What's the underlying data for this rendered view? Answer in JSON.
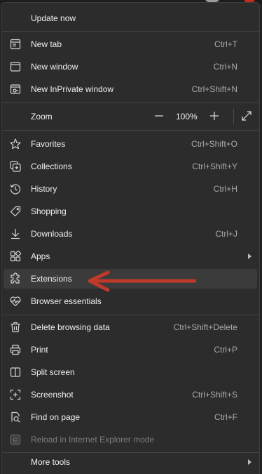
{
  "menu": {
    "update": {
      "label": "Update now"
    },
    "new_tab": {
      "label": "New tab",
      "shortcut": "Ctrl+T",
      "icon": "new-tab-icon"
    },
    "new_window": {
      "label": "New window",
      "shortcut": "Ctrl+N",
      "icon": "window-icon"
    },
    "inprivate": {
      "label": "New InPrivate window",
      "shortcut": "Ctrl+Shift+N",
      "icon": "inprivate-icon"
    },
    "zoom": {
      "label": "Zoom",
      "value": "100%",
      "minus_icon": "minus-icon",
      "plus_icon": "plus-icon",
      "fullscreen_icon": "fullscreen-icon"
    },
    "favorites": {
      "label": "Favorites",
      "shortcut": "Ctrl+Shift+O",
      "icon": "star-icon"
    },
    "collections": {
      "label": "Collections",
      "shortcut": "Ctrl+Shift+Y",
      "icon": "collections-icon"
    },
    "history": {
      "label": "History",
      "shortcut": "Ctrl+H",
      "icon": "history-icon"
    },
    "shopping": {
      "label": "Shopping",
      "icon": "tag-icon"
    },
    "downloads": {
      "label": "Downloads",
      "shortcut": "Ctrl+J",
      "icon": "download-icon"
    },
    "apps": {
      "label": "Apps",
      "icon": "apps-icon"
    },
    "extensions": {
      "label": "Extensions",
      "icon": "puzzle-icon"
    },
    "essentials": {
      "label": "Browser essentials",
      "icon": "heart-pulse-icon"
    },
    "delete": {
      "label": "Delete browsing data",
      "shortcut": "Ctrl+Shift+Delete",
      "icon": "trash-icon"
    },
    "print": {
      "label": "Print",
      "shortcut": "Ctrl+P",
      "icon": "printer-icon"
    },
    "split": {
      "label": "Split screen",
      "icon": "split-screen-icon"
    },
    "screenshot": {
      "label": "Screenshot",
      "shortcut": "Ctrl+Shift+S",
      "icon": "screenshot-icon"
    },
    "find": {
      "label": "Find on page",
      "shortcut": "Ctrl+F",
      "icon": "find-icon"
    },
    "ie_mode": {
      "label": "Reload in Internet Explorer mode",
      "icon": "ie-icon"
    },
    "more_tools": {
      "label": "More tools"
    }
  },
  "colors": {
    "menu_bg": "#2c2c2c",
    "highlight": "#3b3b3b",
    "annotation_arrow": "#c0392b"
  }
}
